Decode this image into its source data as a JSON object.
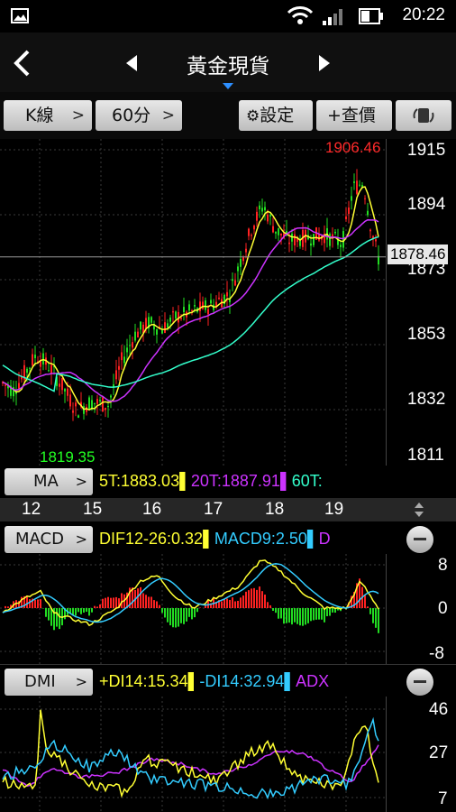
{
  "status": {
    "time": "20:22"
  },
  "header": {
    "title": "黃金現貨",
    "back_icon": "chevron-left-icon",
    "prev_icon": "triangle-left-icon",
    "next_icon": "triangle-right-icon"
  },
  "toolbar": {
    "kline_label": "K線",
    "period_label": "60分",
    "settings_label": "設定",
    "add_label": "+查價"
  },
  "price_panel": {
    "axis_labels": [
      "1915",
      "1894",
      "1873",
      "1853",
      "1832",
      "1811"
    ],
    "high_label": "1906.46",
    "low_label": "1819.35",
    "last_price": "1878.46"
  },
  "ma": {
    "button": "MA",
    "legend": [
      {
        "text": "5T:1883.03",
        "color": "#ffff33"
      },
      {
        "text": "20T:1887.91",
        "color": "#cc33ff"
      },
      {
        "text": "60T:",
        "color": "#33ffcc"
      }
    ]
  },
  "dates": [
    "12",
    "15",
    "16",
    "17",
    "18",
    "19"
  ],
  "macd": {
    "button": "MACD",
    "legend": [
      {
        "text": "DIF12-26:0.32",
        "color": "#ffff33"
      },
      {
        "text": "MACD9:2.50",
        "color": "#33ccff"
      },
      {
        "text": "D",
        "color": "#cc33ff"
      }
    ],
    "axis_labels": [
      "8",
      "0",
      "-8"
    ]
  },
  "dmi": {
    "button": "DMI",
    "legend": [
      {
        "text": "+DI14:15.34",
        "color": "#ffff33"
      },
      {
        "text": "-DI14:32.94",
        "color": "#33ccff"
      },
      {
        "text": "ADX",
        "color": "#cc33ff"
      }
    ],
    "axis_labels": [
      "46",
      "27",
      "7"
    ]
  },
  "colors": {
    "up": "#ff2222",
    "down": "#22dd22",
    "ma5": "#ffff33",
    "ma20": "#cc33ff",
    "ma60": "#33ffcc"
  }
}
